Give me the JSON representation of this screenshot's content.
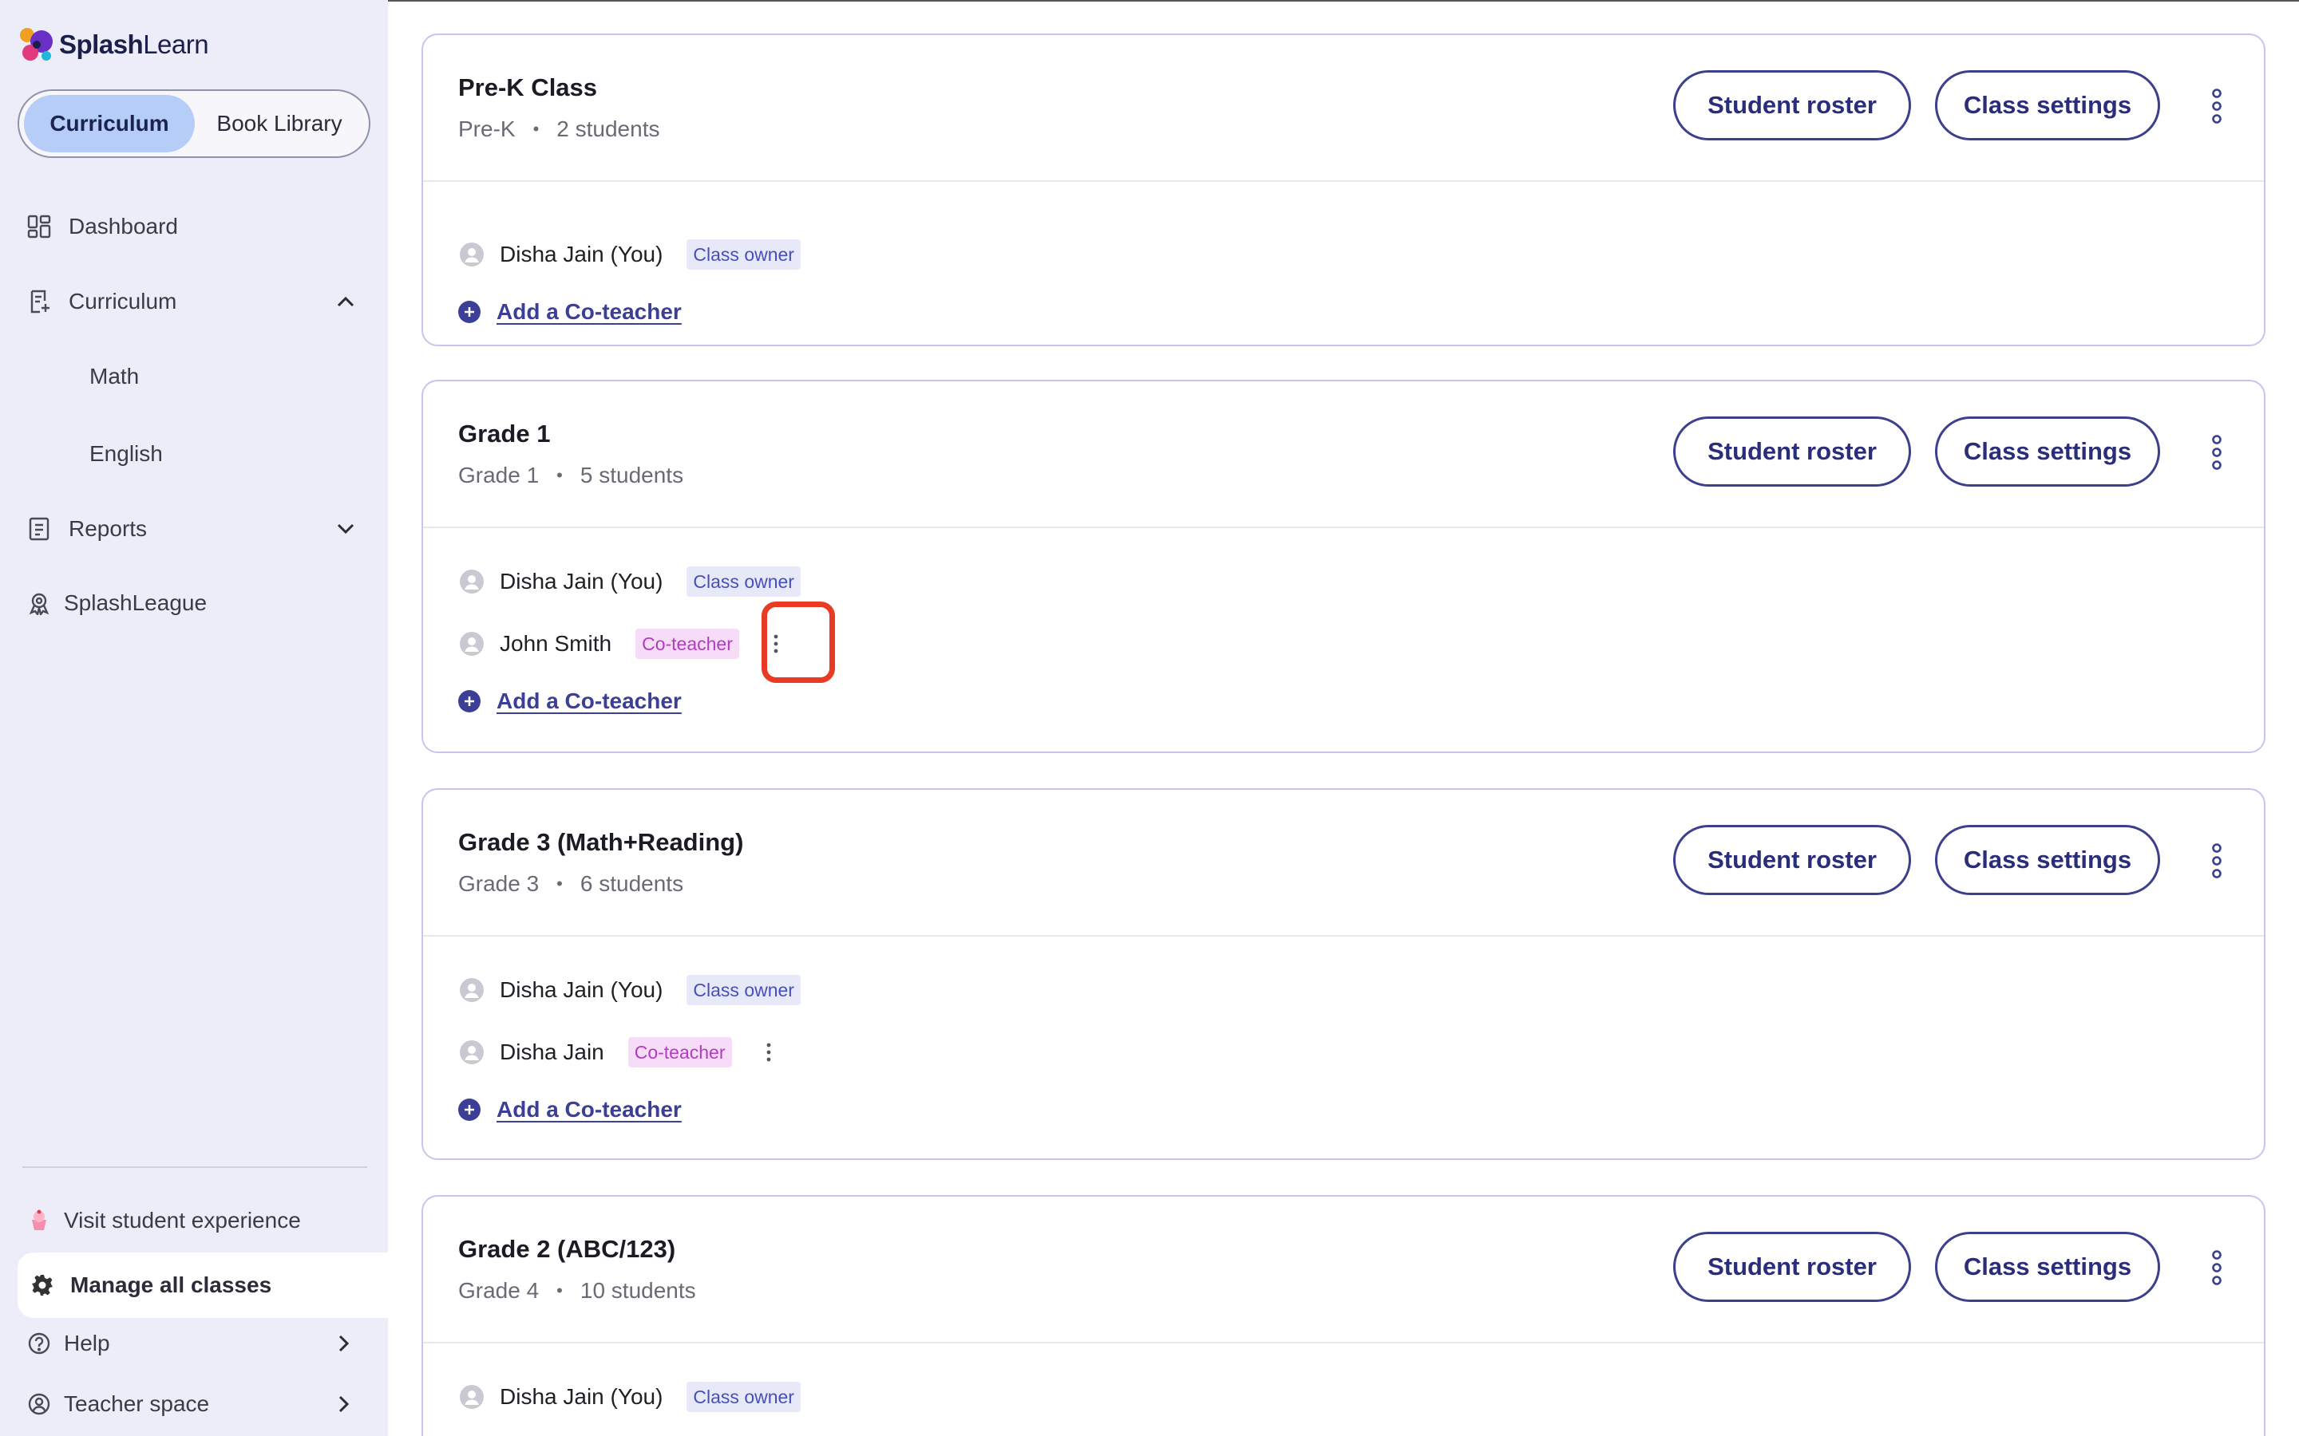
{
  "brand": {
    "name_bold": "Splash",
    "name_rest": "Learn"
  },
  "segmented": {
    "active": "Curriculum",
    "inactive": "Book Library"
  },
  "nav": {
    "dashboard": "Dashboard",
    "curriculum": "Curriculum",
    "math": "Math",
    "english": "English",
    "reports": "Reports",
    "splashleague": "SplashLeague"
  },
  "bottom": {
    "visit": "Visit student experience",
    "manage": "Manage all classes",
    "help": "Help",
    "teacher_space": "Teacher space"
  },
  "buttons": {
    "roster": "Student roster",
    "settings": "Class settings"
  },
  "labels": {
    "owner": "Class owner",
    "co": "Co-teacher",
    "add": "Add a Co-teacher"
  },
  "classes": [
    {
      "title": "Pre-K Class",
      "grade": "Pre-K",
      "students": "2 students",
      "teachers": [
        {
          "name": "Disha Jain (You)",
          "role": "owner"
        }
      ]
    },
    {
      "title": "Grade 1",
      "grade": "Grade 1",
      "students": "5 students",
      "teachers": [
        {
          "name": "Disha Jain (You)",
          "role": "owner"
        },
        {
          "name": "John Smith",
          "role": "co"
        }
      ]
    },
    {
      "title": "Grade 3 (Math+Reading)",
      "grade": "Grade 3",
      "students": "6 students",
      "teachers": [
        {
          "name": "Disha Jain (You)",
          "role": "owner"
        },
        {
          "name": "Disha Jain",
          "role": "co"
        }
      ]
    },
    {
      "title": "Grade 2 (ABC/123)",
      "grade": "Grade 4",
      "students": "10 students",
      "teachers": [
        {
          "name": "Disha Jain (You)",
          "role": "owner"
        }
      ]
    }
  ],
  "colors": {
    "accent": "#3c3f8c",
    "highlight": "#e83a24",
    "owner_badge": "#4650b8",
    "co_badge": "#b13cc1",
    "sidebar_bg": "#ecedf8"
  },
  "icons": [
    "splashlearn-logo",
    "dashboard-icon",
    "curriculum-icon",
    "reports-icon",
    "splashleague-icon",
    "chevron-up-icon",
    "chevron-down-icon",
    "chevron-right-icon",
    "cupcake-icon",
    "gear-icon",
    "help-icon",
    "teacher-icon",
    "kebab-icon",
    "avatar-icon",
    "plus-icon"
  ]
}
